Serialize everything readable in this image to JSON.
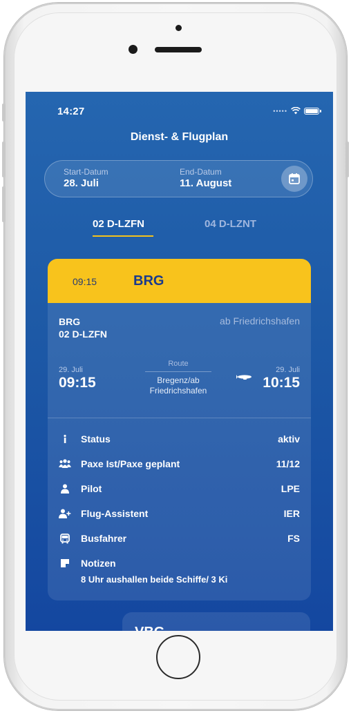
{
  "status_bar": {
    "time": "14:27"
  },
  "header": {
    "title": "Dienst- & Flugplan"
  },
  "date_range": {
    "start_label": "Start-Datum",
    "start_value": "28. Juli",
    "end_label": "End-Datum",
    "end_value": "11. August",
    "calendar_icon": "calendar-icon"
  },
  "tabs": [
    {
      "label": "02 D-LZFN",
      "active": true
    },
    {
      "label": "04 D-LZNT",
      "active": false
    }
  ],
  "flight_card": {
    "time": "09:15",
    "code": "BRG",
    "origin_code": "BRG",
    "aircraft": "02 D-LZFN",
    "departure_note": "ab Friedrichshafen",
    "dep_date": "29. Juli",
    "dep_time": "09:15",
    "route_label": "Route",
    "route_value_1": "Bregenz/ab",
    "route_value_2": "Friedrichshafen",
    "arr_date": "29. Juli",
    "arr_time": "10:15",
    "details": [
      {
        "icon": "info-icon",
        "label": "Status",
        "value": "aktiv"
      },
      {
        "icon": "group-icon",
        "label": "Paxe Ist/Paxe geplant",
        "value": "11/12"
      },
      {
        "icon": "person-icon",
        "label": "Pilot",
        "value": "LPE"
      },
      {
        "icon": "person-add-icon",
        "label": "Flug-Assistent",
        "value": "IER"
      },
      {
        "icon": "bus-icon",
        "label": "Busfahrer",
        "value": "FS"
      },
      {
        "icon": "note-icon",
        "label": "Notizen",
        "value": ""
      }
    ],
    "note": "8 Uhr aushallen beide Schiffe/ 3 Ki"
  },
  "next_card": {
    "code": "VBG"
  },
  "colors": {
    "accent": "#f8c31c",
    "background": "#1d59a6"
  }
}
